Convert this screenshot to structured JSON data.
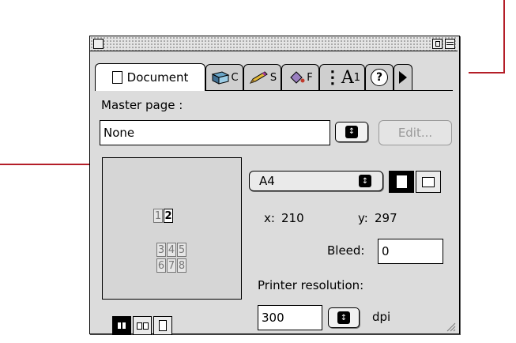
{
  "tabs": [
    {
      "label": "Document",
      "icon": "document-icon",
      "active": true
    },
    {
      "label": "C",
      "icon": "cube-icon"
    },
    {
      "label": "S",
      "icon": "pencil-icon"
    },
    {
      "label": "F",
      "icon": "paint-bucket-icon"
    },
    {
      "label": "A",
      "icon": "text-style-icon"
    }
  ],
  "help_icon": "help-icon",
  "more_icon": "arrow-right-icon",
  "master_page": {
    "label": "Master page :",
    "value": "None",
    "edit_label": "Edit..."
  },
  "page_preview": {
    "pages_row1": [
      "1",
      "2"
    ],
    "pages_row2": [
      "3",
      "4",
      "5"
    ],
    "pages_row3": [
      "6",
      "7",
      "8"
    ],
    "selected_page": "2"
  },
  "page_size": {
    "value": "A4",
    "x_label": "x:",
    "x_value": "210",
    "y_label": "y:",
    "y_value": "297",
    "bleed_label": "Bleed:",
    "bleed_value": "0",
    "orientation": "portrait"
  },
  "printer_resolution": {
    "label": "Printer resolution:",
    "value": "300",
    "unit": "dpi"
  },
  "colors": {
    "callout": "#b41e28",
    "panel_bg": "#dcdcdc"
  }
}
